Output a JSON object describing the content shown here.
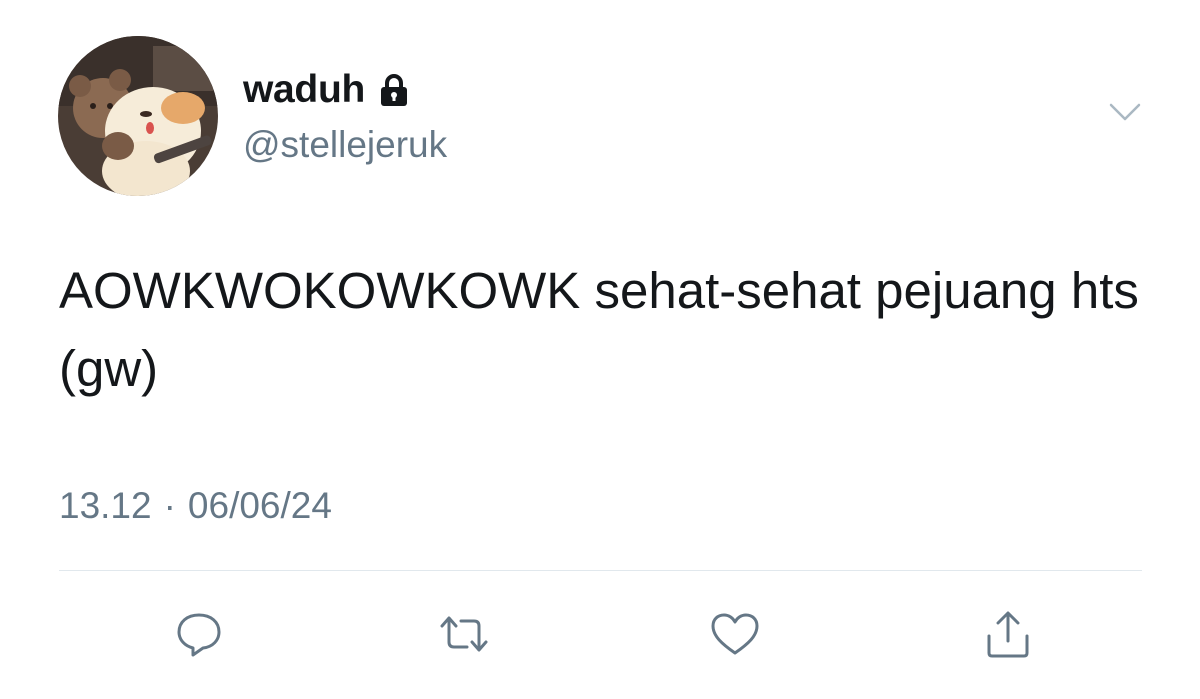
{
  "author": {
    "display_name": "waduh",
    "handle": "@stellejeruk",
    "protected_icon": "lock-icon",
    "avatar_icon": "avatar-bear-puppy"
  },
  "tweet": {
    "text": "AOWKWOKOWKOWK sehat-sehat pejuang hts (gw)",
    "time": "13.12",
    "separator": "·",
    "date": "06/06/24"
  },
  "actions": {
    "reply_icon": "reply-icon",
    "retweet_icon": "retweet-icon",
    "like_icon": "heart-icon",
    "share_icon": "share-icon",
    "menu_icon": "chevron-down-icon"
  },
  "colors": {
    "text": "#14171a",
    "secondary": "#657786",
    "icon": "#657786",
    "divider": "#e1e8ed",
    "background": "#ffffff"
  }
}
